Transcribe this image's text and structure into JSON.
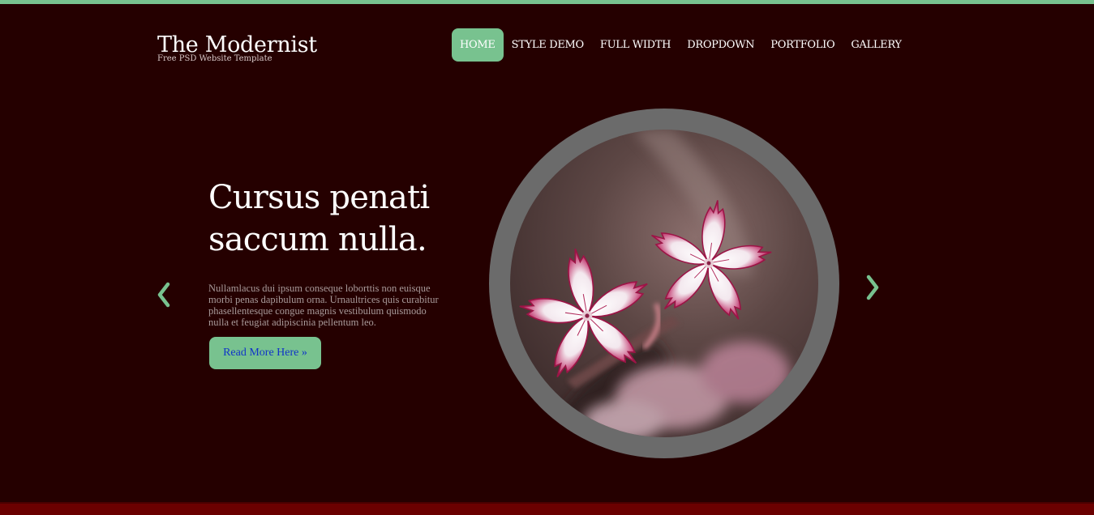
{
  "site": {
    "title": "The Modernist",
    "tagline": "Free PSD Website Template"
  },
  "nav": {
    "items": [
      {
        "label": "HOME",
        "active": true
      },
      {
        "label": "STYLE DEMO",
        "active": false
      },
      {
        "label": "FULL WIDTH",
        "active": false
      },
      {
        "label": "DROPDOWN",
        "active": false
      },
      {
        "label": "PORTFOLIO",
        "active": false
      },
      {
        "label": "GALLERY",
        "active": false
      }
    ]
  },
  "slide": {
    "heading_line1": "Cursus penati",
    "heading_line2": "saccum nulla.",
    "body": "Nullamlacus dui ipsum conseque loborttis non euisque morbi penas dapibulum orna. Urnaultrices quis curabitur phasellentesque congue magnis vestibulum quismodo nulla et feugiat adipiscinia pellentum leo.",
    "cta_label": "Read More Here »",
    "image_subject": "pink-white-flowers"
  },
  "slider_controls": {
    "prev_icon": "chevron-left-icon",
    "next_icon": "chevron-right-icon"
  },
  "colors": {
    "background": "#250000",
    "accent": "#78c28f",
    "footer_bar": "#6a0000",
    "link": "#1034c8",
    "ring": "#6b6b6b"
  }
}
